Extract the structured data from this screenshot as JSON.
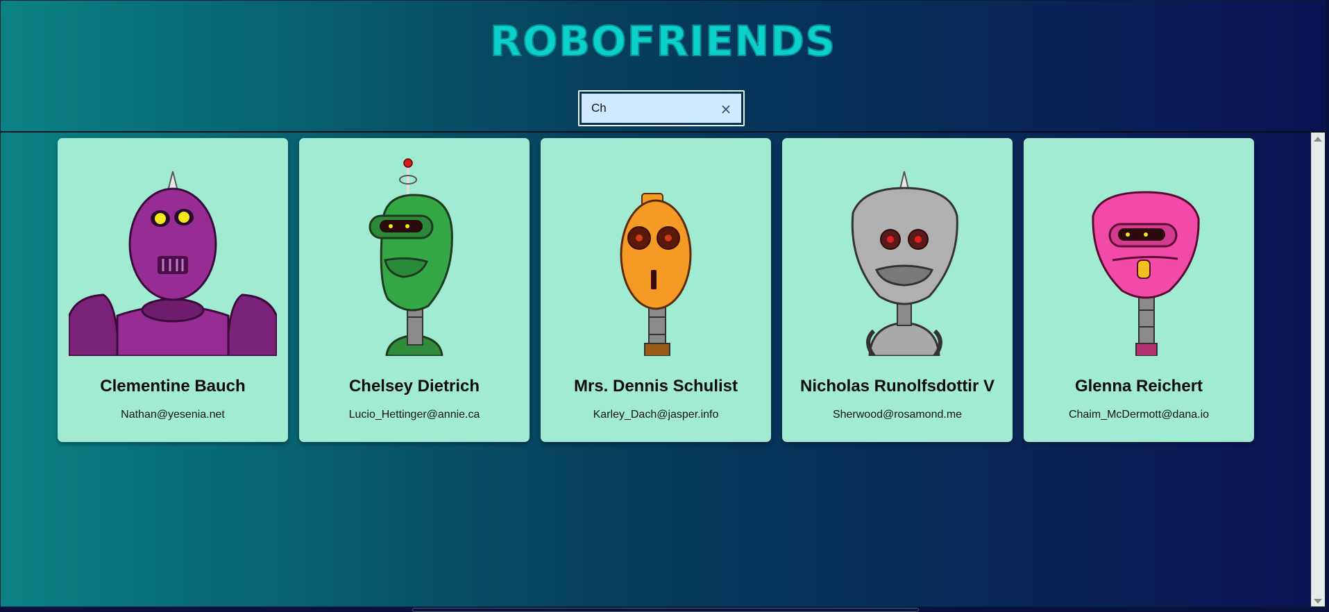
{
  "app": {
    "title": "ROBOFRIENDS"
  },
  "search": {
    "value": "Ch",
    "placeholder": "",
    "clear_icon": "close-icon",
    "clear_glyph": "×"
  },
  "robots": [
    {
      "name": "Clementine Bauch",
      "email": "Nathan@yesenia.net",
      "color": "#8e2a8f",
      "icon": "robot-avatar-purple"
    },
    {
      "name": "Chelsey Dietrich",
      "email": "Lucio_Hettinger@annie.ca",
      "color": "#2ea443",
      "icon": "robot-avatar-green"
    },
    {
      "name": "Mrs. Dennis Schulist",
      "email": "Karley_Dach@jasper.info",
      "color": "#f59a24",
      "icon": "robot-avatar-orange"
    },
    {
      "name": "Nicholas Runolfsdottir V",
      "email": "Sherwood@rosamond.me",
      "color": "#a9a9a9",
      "icon": "robot-avatar-gray"
    },
    {
      "name": "Glenna Reichert",
      "email": "Chaim_McDermott@dana.io",
      "color": "#f24aa8",
      "icon": "robot-avatar-pink"
    }
  ],
  "colors": {
    "gradient_start": "#0a8284",
    "gradient_end": "#0a1352",
    "card_bg": "#a1ebd3",
    "title": "#0bd0cc"
  }
}
